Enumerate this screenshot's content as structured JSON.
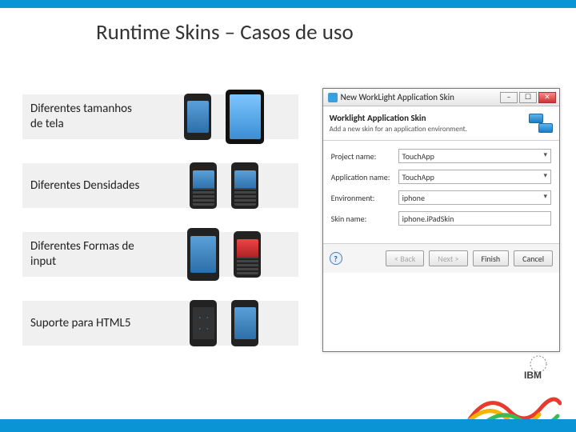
{
  "title": "Runtime Skins – Casos de uso",
  "rows": [
    {
      "label": "Diferentes tamanhos de tela"
    },
    {
      "label": "Diferentes Densidades"
    },
    {
      "label": "Diferentes Formas de input"
    },
    {
      "label": "Suporte para HTML5"
    }
  ],
  "dialog": {
    "window_title": "New WorkLight Application Skin",
    "heading": "Worklight Application Skin",
    "subheading": "Add a new skin for an application environment.",
    "fields": {
      "project_label": "Project name:",
      "project_value": "TouchApp",
      "app_label": "Application name:",
      "app_value": "TouchApp",
      "env_label": "Environment:",
      "env_value": "iphone",
      "skin_label": "Skin name:",
      "skin_value": "iphone.iPadSkin"
    },
    "buttons": {
      "back": "< Back",
      "next": "Next >",
      "finish": "Finish",
      "cancel": "Cancel"
    },
    "win": {
      "min": "–",
      "max": "☐",
      "close": "✕"
    },
    "help": "?"
  },
  "logo": "IBM"
}
